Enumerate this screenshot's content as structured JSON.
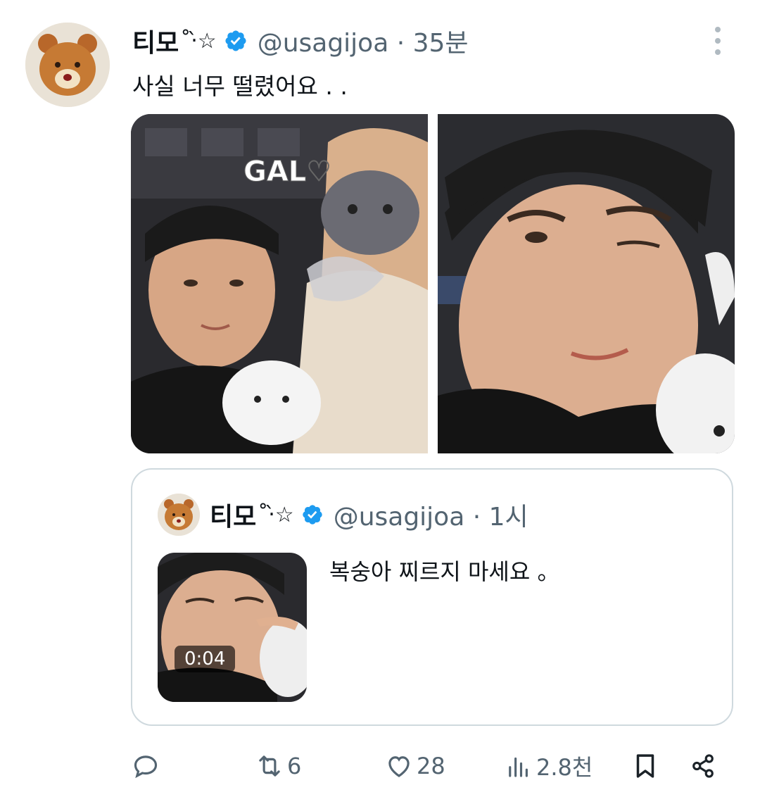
{
  "tweet": {
    "author_name": "티모",
    "author_name_deco": "˚‧̀☆",
    "handle_time": "@usagijoa · 35분",
    "text": "사실 너무 떨렸어요 . ."
  },
  "quoted_tweet": {
    "author_name": "티모",
    "author_name_deco": "˚‧̀☆",
    "handle_time": "@usagijoa · 1시",
    "text": "복숭아 찌르지 마세요 。",
    "video_duration": "0:04"
  },
  "actions": {
    "reply_count": "",
    "retweet_count": "6",
    "like_count": "28",
    "view_count": "2.8천"
  },
  "colors": {
    "verified_badge": "#1d9bf0",
    "muted_text": "#536471",
    "border": "#cfd9de"
  },
  "icons": [
    "more-icon",
    "verified-icon",
    "reply-icon",
    "retweet-icon",
    "like-icon",
    "views-icon",
    "bookmark-icon",
    "share-icon"
  ]
}
